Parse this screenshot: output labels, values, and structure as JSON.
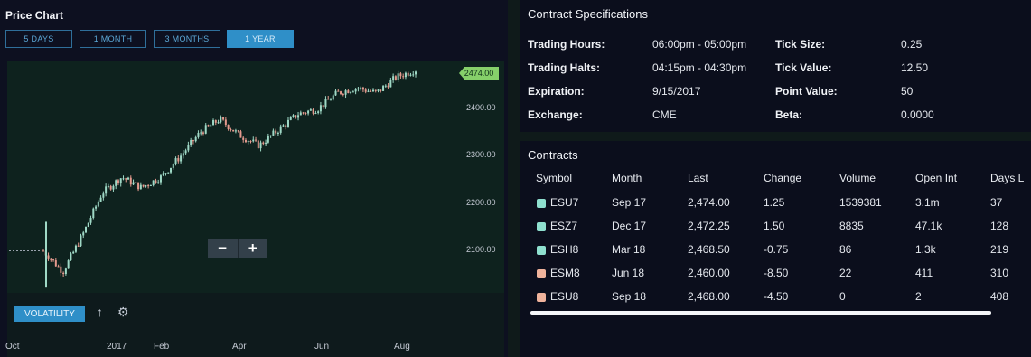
{
  "price_chart": {
    "title": "Price Chart",
    "ranges": [
      "5 DAYS",
      "1 MONTH",
      "3 MONTHS",
      "1 YEAR"
    ],
    "active_range": "1 YEAR",
    "last_price_tag": "2474.00",
    "y_ticks": [
      "2400.00",
      "2300.00",
      "2200.00",
      "2100.00"
    ],
    "x_ticks": [
      "Oct",
      "2017",
      "Feb",
      "Apr",
      "Jun",
      "Aug"
    ],
    "zoom_out": "−",
    "zoom_in": "+",
    "volatility_label": "VOLATILITY",
    "up_arrow_icon": "arrow-up-icon",
    "settings_icon": "gear-icon",
    "colors": {
      "up": "#9fd9c6",
      "down": "#e59a8e",
      "tag": "#86d06a",
      "accent": "#2f8fc8"
    }
  },
  "chart_data": {
    "type": "candlestick",
    "x_ticks": [
      "Oct",
      "2017",
      "Feb",
      "Apr",
      "Jun",
      "Aug"
    ],
    "ylim": [
      2050,
      2490
    ],
    "y_ticks": [
      2100,
      2200,
      2300,
      2400
    ],
    "last": 2474.0,
    "trend": [
      {
        "date": "Oct",
        "close": 2130
      },
      {
        "date": "Nov",
        "close": 2090
      },
      {
        "date": "Nov",
        "close": 2160
      },
      {
        "date": "Dec",
        "close": 2240
      },
      {
        "date": "Dec",
        "close": 2270
      },
      {
        "date": "Jan",
        "close": 2250
      },
      {
        "date": "Jan",
        "close": 2270
      },
      {
        "date": "Feb",
        "close": 2310
      },
      {
        "date": "Feb",
        "close": 2355
      },
      {
        "date": "Mar",
        "close": 2380
      },
      {
        "date": "Mar",
        "close": 2350
      },
      {
        "date": "Apr",
        "close": 2330
      },
      {
        "date": "Apr",
        "close": 2360
      },
      {
        "date": "May",
        "close": 2390
      },
      {
        "date": "May",
        "close": 2400
      },
      {
        "date": "Jun",
        "close": 2430
      },
      {
        "date": "Jun",
        "close": 2440
      },
      {
        "date": "Jul",
        "close": 2430
      },
      {
        "date": "Jul",
        "close": 2460
      },
      {
        "date": "Aug",
        "close": 2474
      }
    ]
  },
  "specs": {
    "title": "Contract Specifications",
    "rows": [
      {
        "label": "Trading Hours:",
        "value": "06:00pm - 05:00pm",
        "label2": "Tick Size:",
        "value2": "0.25"
      },
      {
        "label": "Trading Halts:",
        "value": "04:15pm - 04:30pm",
        "label2": "Tick Value:",
        "value2": "12.50"
      },
      {
        "label": "Expiration:",
        "value": "9/15/2017",
        "label2": "Point Value:",
        "value2": "50"
      },
      {
        "label": "Exchange:",
        "value": "CME",
        "label2": "Beta:",
        "value2": "0.0000"
      }
    ]
  },
  "contracts": {
    "title": "Contracts",
    "headers": [
      "Symbol",
      "Month",
      "Last",
      "Change",
      "Volume",
      "Open Int",
      "Days L"
    ],
    "rows": [
      {
        "symbol": "ESU7",
        "month": "Sep 17",
        "last": "2,474.00",
        "change": "1.25",
        "volume": "1539381",
        "open_int": "3.1m",
        "days": "37",
        "color": "#8fe0cf"
      },
      {
        "symbol": "ESZ7",
        "month": "Dec 17",
        "last": "2,472.25",
        "change": "1.50",
        "volume": "8835",
        "open_int": "47.1k",
        "days": "128",
        "color": "#8fe0cf"
      },
      {
        "symbol": "ESH8",
        "month": "Mar 18",
        "last": "2,468.50",
        "change": "-0.75",
        "volume": "86",
        "open_int": "1.3k",
        "days": "219",
        "color": "#8fe0cf"
      },
      {
        "symbol": "ESM8",
        "month": "Jun 18",
        "last": "2,460.00",
        "change": "-8.50",
        "volume": "22",
        "open_int": "411",
        "days": "310",
        "color": "#f0b39c"
      },
      {
        "symbol": "ESU8",
        "month": "Sep 18",
        "last": "2,468.00",
        "change": "-4.50",
        "volume": "0",
        "open_int": "2",
        "days": "408",
        "color": "#f0b39c"
      }
    ]
  }
}
